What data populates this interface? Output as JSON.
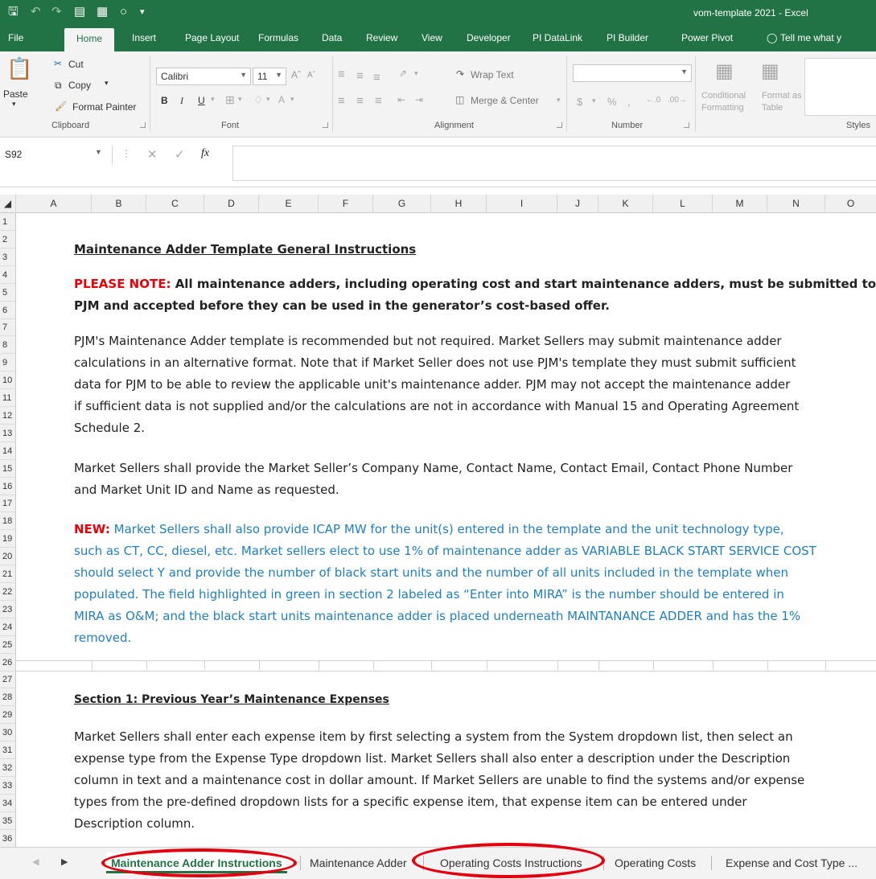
{
  "window": {
    "title": "vom-template 2021 - Excel"
  },
  "ribbon_tabs": [
    "File",
    "Home",
    "Insert",
    "Page Layout",
    "Formulas",
    "Data",
    "Review",
    "View",
    "Developer",
    "PI DataLink",
    "PI Builder",
    "Power Pivot",
    "Tell me what y"
  ],
  "ribbon": {
    "paste": "Paste",
    "cut": "Cut",
    "copy": "Copy",
    "format_painter": "Format Painter",
    "font_name": "Calibri",
    "font_size": "11",
    "wrap_text": "Wrap Text",
    "merge_center": "Merge & Center",
    "number_format": "",
    "conditional_formatting": "Conditional Formatting",
    "format_as_table": "Format as Table",
    "groups": {
      "clipboard": "Clipboard",
      "font": "Font",
      "alignment": "Alignment",
      "number": "Number",
      "styles": "Styles"
    }
  },
  "formula_bar": {
    "name_box": "S92",
    "fx": "fx",
    "formula": ""
  },
  "columns": [
    "A",
    "B",
    "C",
    "D",
    "E",
    "F",
    "G",
    "H",
    "I",
    "J",
    "K",
    "L",
    "M",
    "N",
    "O"
  ],
  "rows": [
    "1",
    "2",
    "3",
    "4",
    "5",
    "6",
    "7",
    "8",
    "9",
    "10",
    "11",
    "12",
    "13",
    "14",
    "15",
    "16",
    "17",
    "18",
    "19",
    "20",
    "21",
    "22",
    "23",
    "24",
    "25",
    "26",
    "27",
    "28",
    "29",
    "30",
    "31",
    "32",
    "33",
    "34",
    "35",
    "36"
  ],
  "content": {
    "title": "Maintenance Adder Template General Instructions",
    "note_label": "PLEASE NOTE:",
    "note_line1": "All maintenance adders, including operating cost and start maintenance adders, must be submitted to",
    "note_line2": "PJM and accepted before they can be used in the generator’s cost-based offer.",
    "p1": [
      "PJM's Maintenance Adder template is recommended but not required. Market Sellers may submit maintenance adder",
      "calculations in an alternative format. Note that if Market Seller does not use PJM's template they must submit sufficient",
      "data for PJM to be able to review the applicable unit's maintenance adder. PJM may not accept the maintenance adder",
      "if sufficient data is not supplied and/or the calculations are not in accordance with Manual 15 and Operating Agreement",
      "Schedule 2."
    ],
    "p2": [
      "Market Sellers shall provide the Market Seller’s Company Name, Contact Name, Contact Email, Contact Phone Number",
      "and Market Unit ID and Name as requested."
    ],
    "new_label": "NEW:",
    "new_line1": "Market Sellers shall also provide ICAP MW for the unit(s) entered in the template and the unit technology type,",
    "new_lines": [
      "such as CT, CC, diesel, etc. Market sellers elect to use 1% of maintenance adder as VARIABLE BLACK START SERVICE COST",
      "should select Y and provide the number of black start units and the number of all units included in the template when",
      "populated. The field highlighted in green in section 2 labeled as “Enter into MIRA” is the number should be entered in",
      "MIRA as O&M; and the black start units maintenance adder is placed underneath MAINTANANCE ADDER and has the 1%",
      "removed."
    ],
    "section1_title": "Section 1: Previous Year’s Maintenance Expenses",
    "p3": [
      "Market Sellers shall enter each expense item by first selecting a system from the System dropdown list, then select an",
      "expense type from the Expense Type dropdown list. Market Sellers shall also enter a description under the Description",
      "column in text and a maintenance cost in dollar amount. If Market Sellers are unable to find the systems and/or expense",
      "types from the pre-defined dropdown lists for a specific expense item, that expense item can be entered under",
      "Description column."
    ]
  },
  "sheet_tabs": [
    "Maintenance Adder Instructions",
    "Maintenance Adder",
    "Operating Costs Instructions",
    "Operating Costs",
    "Expense and Cost Type ..."
  ],
  "colors": {
    "excel_green": "#217346",
    "note_red": "#e8000b",
    "new_blue": "#1f7fc1",
    "annotation_red": "#e3000f"
  }
}
